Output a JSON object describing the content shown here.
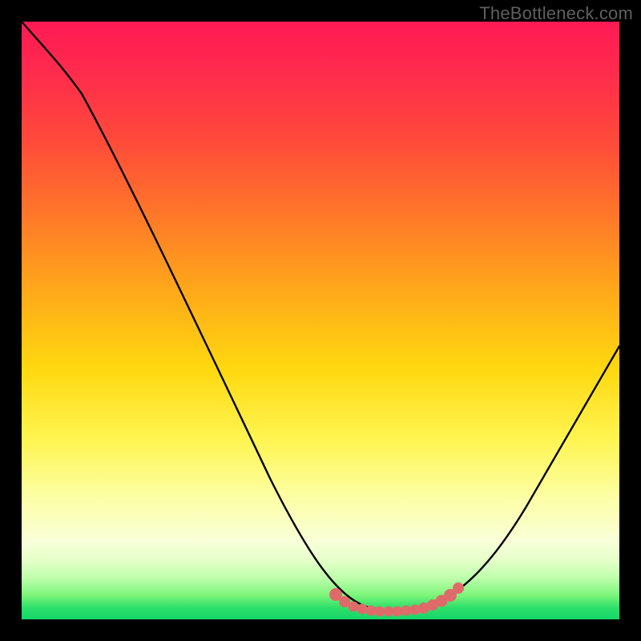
{
  "watermark": {
    "text": "TheBottleneck.com"
  },
  "colors": {
    "page_bg": "#000000",
    "curve_stroke": "#000000",
    "marker_fill": "#e06a6a",
    "gradient_stops": [
      "#ff1a55",
      "#ff2a4d",
      "#ff4a3a",
      "#ff7a28",
      "#ffa81a",
      "#ffd80f",
      "#fff552",
      "#fcffa8",
      "#f9ffd8",
      "#e6ffca",
      "#bfffad",
      "#7cf57a",
      "#2ee06a",
      "#14d66a"
    ]
  },
  "chart_data": {
    "type": "line",
    "title": "",
    "xlabel": "",
    "ylabel": "",
    "xlim": [
      0,
      100
    ],
    "ylim": [
      0,
      100
    ],
    "series": [
      {
        "name": "bottleneck-curve",
        "description": "V-shaped bottleneck curve with flat minimum region",
        "x": [
          0,
          5,
          10,
          15,
          20,
          25,
          30,
          35,
          40,
          45,
          50,
          53,
          56,
          60,
          63,
          66,
          70,
          75,
          80,
          85,
          90,
          95,
          100
        ],
        "y": [
          100,
          94,
          85,
          75,
          65,
          55,
          45,
          35,
          25,
          16,
          8,
          3,
          1,
          0,
          0,
          0,
          1,
          5,
          12,
          22,
          33,
          44,
          55
        ]
      }
    ],
    "markers": {
      "name": "flat-minimum-dots",
      "x": [
        52,
        54,
        56,
        58,
        60,
        62,
        64,
        66,
        68,
        70,
        72
      ],
      "y": [
        3,
        1.5,
        0.8,
        0.4,
        0.2,
        0.2,
        0.3,
        0.6,
        1.2,
        2,
        3.5
      ]
    }
  }
}
